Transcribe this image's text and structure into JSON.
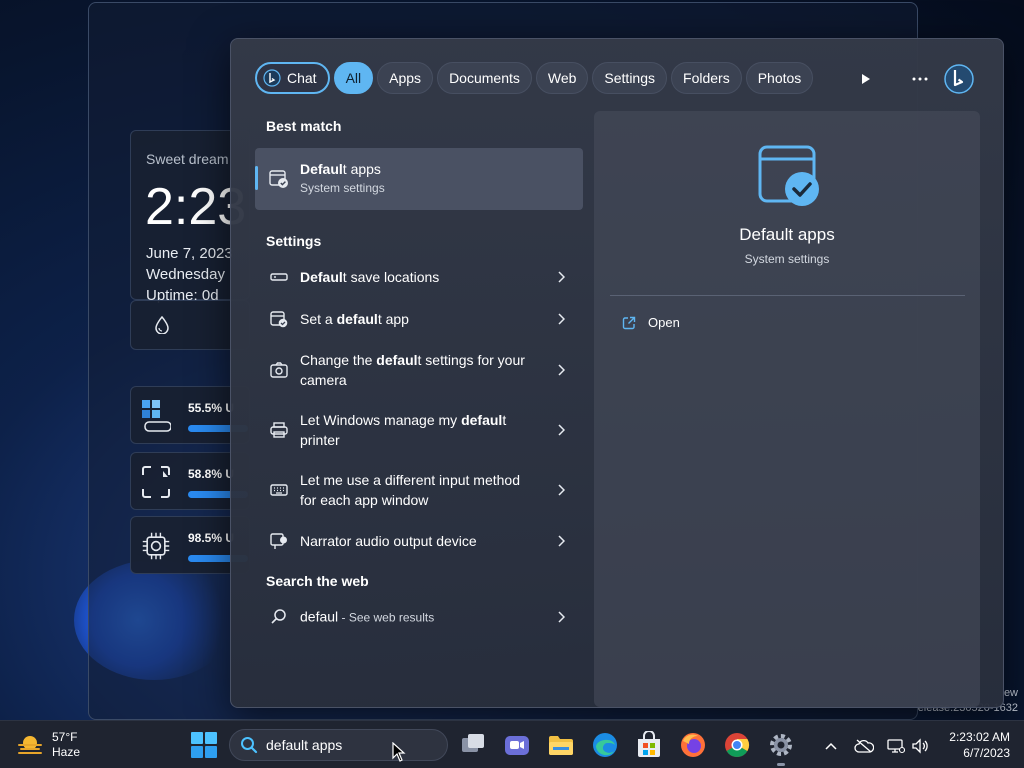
{
  "desktop": {
    "watermark_lines": [
      "ew",
      "elease.230520-1632"
    ]
  },
  "widget": {
    "greeting": "Sweet dream",
    "time": "2:23",
    "date": "June 7, 2023",
    "day": "Wednesday",
    "uptime": "Uptime: 0d",
    "meters": [
      {
        "value": "55.5% U",
        "icon": "memory-icon",
        "level": 0.555
      },
      {
        "value": "58.8% U",
        "icon": "storage-icon",
        "level": 0.588
      },
      {
        "value": "98.5% U",
        "icon": "cpu-icon",
        "level": 0.985
      }
    ]
  },
  "search_panel": {
    "filters": [
      {
        "label": "Chat",
        "name": "chat"
      },
      {
        "label": "All",
        "name": "all",
        "active": true
      },
      {
        "label": "Apps",
        "name": "apps"
      },
      {
        "label": "Documents",
        "name": "documents"
      },
      {
        "label": "Web",
        "name": "web"
      },
      {
        "label": "Settings",
        "name": "settings"
      },
      {
        "label": "Folders",
        "name": "folders"
      },
      {
        "label": "Photos",
        "name": "photos"
      }
    ],
    "best_match_header": "Best match",
    "best_match": {
      "title_bold": "Defaul",
      "title_rest": "t apps",
      "subtitle": "System settings"
    },
    "settings_header": "Settings",
    "settings_items": [
      {
        "pre": "",
        "bold": "Defaul",
        "post": "t save locations",
        "icon": "storage-bar-icon"
      },
      {
        "pre": "Set a ",
        "bold": "defaul",
        "post": "t app",
        "icon": "default-apps-icon"
      },
      {
        "pre": "Change the ",
        "bold": "defaul",
        "post": "t settings for your camera",
        "icon": "camera-icon"
      },
      {
        "pre": "Let Windows manage my ",
        "bold": "defaul",
        "post": "t printer",
        "icon": "printer-icon"
      },
      {
        "pre": "Let me use a different input method for each app window",
        "bold": "",
        "post": "",
        "icon": "keyboard-icon"
      },
      {
        "pre": "Narrator audio output device",
        "bold": "",
        "post": "",
        "icon": "narrator-icon"
      }
    ],
    "web_header": "Search the web",
    "web_item": {
      "query": "defaul",
      "suffix": " - See web results"
    },
    "preview": {
      "title": "Default apps",
      "subtitle": "System settings",
      "open_label": "Open"
    }
  },
  "taskbar": {
    "weather": {
      "temp": "57°F",
      "condition": "Haze"
    },
    "search_value": "default apps",
    "clock_time": "2:23:02 AM",
    "clock_date": "6/7/2023"
  },
  "colors": {
    "accent": "#5fb6f2",
    "panel": "#343a48",
    "taskbar": "#1f2430"
  }
}
